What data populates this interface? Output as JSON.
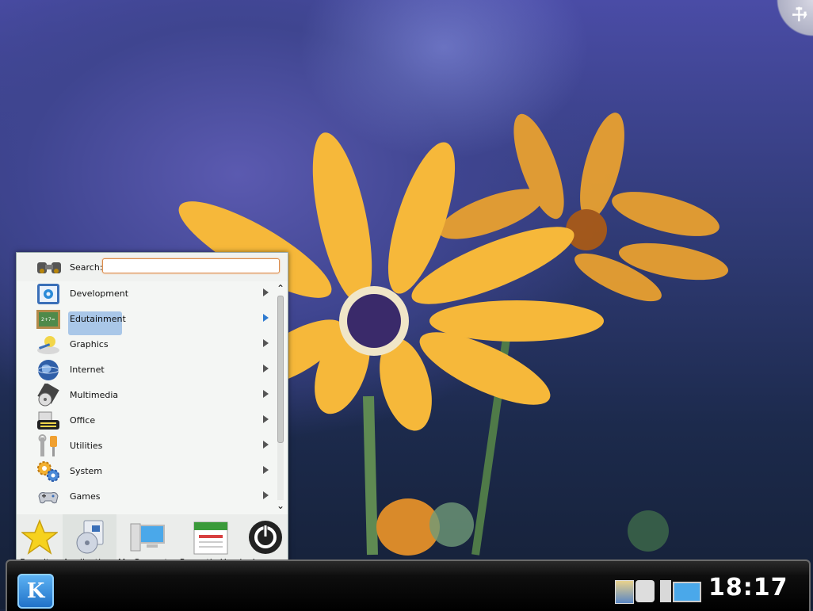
{
  "desktop": {
    "wallpaper": "yellow-daisy-flowers",
    "toolbox_icon": "wrench-icon"
  },
  "launcher": {
    "search": {
      "label": "Search:",
      "value": "",
      "placeholder": ""
    },
    "categories": [
      {
        "label": "Development",
        "icon": "development-icon"
      },
      {
        "label": "Edutainment",
        "icon": "edutainment-icon"
      },
      {
        "label": "Graphics",
        "icon": "graphics-icon"
      },
      {
        "label": "Internet",
        "icon": "internet-icon"
      },
      {
        "label": "Multimedia",
        "icon": "multimedia-icon"
      },
      {
        "label": "Office",
        "icon": "office-icon"
      },
      {
        "label": "Utilities",
        "icon": "utilities-icon"
      },
      {
        "label": "System",
        "icon": "system-icon"
      },
      {
        "label": "Games",
        "icon": "games-icon"
      }
    ],
    "selected_category": "Edutainment",
    "tabs": [
      {
        "label": "Favorites",
        "icon": "star-icon"
      },
      {
        "label": "Applications",
        "icon": "applications-icon"
      },
      {
        "label": "My Computer",
        "icon": "computer-icon"
      },
      {
        "label": "Recently Used",
        "icon": "calendar-icon"
      },
      {
        "label": "Leave",
        "icon": "power-icon"
      }
    ],
    "active_tab": "Applications"
  },
  "panel": {
    "kmenu_label": "K",
    "clock": "18:17"
  },
  "colors": {
    "selection": "#a9c7e8",
    "search_border": "#d98a4a",
    "panel": "#000000"
  }
}
